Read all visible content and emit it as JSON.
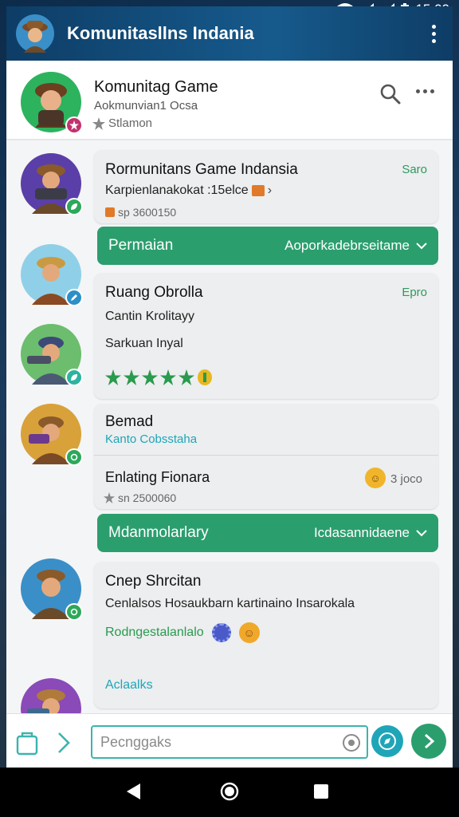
{
  "status_bar": {
    "time": "15:00"
  },
  "app_bar": {
    "title": "Komunitasllns Indania"
  },
  "header": {
    "title": "Komunitag Game",
    "subtitle": "Aokmunvian1 Ocsa",
    "status": "Stlamon"
  },
  "cards": [
    {
      "title": "Rormunitans Game Indansia",
      "time": "Saro",
      "line": "Karpienlanakokat :15elce",
      "meta": "sp 3600150"
    },
    {
      "title": "Ruang Obrolla",
      "time": "Epro",
      "line1": "Cantin Krolitayy",
      "line2": "Sarkuan Inyal",
      "rating_stars": 5
    },
    {
      "title": "Bemad",
      "subtitle": "Kanto Cobsstaha",
      "row_title": "Enlating Fionara",
      "row_count": "3 joco",
      "meta": "sn 2500060"
    },
    {
      "title": "Cnep Shrcitan",
      "line": "Cenlalsos Hosaukbarn kartinaino Insarokala",
      "green_line": "Rodngestalanlalo",
      "link": "Aclaalks"
    }
  ],
  "bars": [
    {
      "label": "Permaian",
      "action": "Aoporkadebrseitame"
    },
    {
      "label": "Mdanmolarlary",
      "action": "Icdasannidaene"
    }
  ],
  "input": {
    "placeholder": "Pecnggaks"
  },
  "colors": {
    "accent": "#2b9e6e",
    "brand": "#165a8c",
    "teal": "#3bb4b0"
  }
}
